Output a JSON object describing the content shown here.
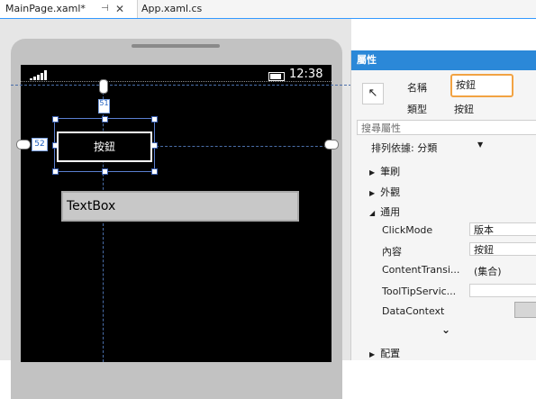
{
  "tabs": [
    {
      "label": "MainPage.xaml*",
      "active": true
    },
    {
      "label": "App.xaml.cs",
      "active": false
    }
  ],
  "designer": {
    "clock": "12:38",
    "button_text": "按鈕",
    "textbox_text": "TextBox",
    "margin_top": "51",
    "margin_left": "52"
  },
  "properties": {
    "title": "屬性",
    "name_label": "名稱",
    "name_value": "按鈕",
    "type_label": "類型",
    "type_value": "按鈕",
    "search_placeholder": "搜尋屬性",
    "arrange_by": "排列依據: 分類",
    "categories": {
      "brush": "筆刷",
      "appearance": "外觀",
      "common": "通用",
      "layout": "配置"
    },
    "common_props": [
      {
        "name": "ClickMode",
        "value": "版本"
      },
      {
        "name": "內容",
        "value": "按鈕"
      },
      {
        "name": "ContentTransi...",
        "value": "(集合)"
      },
      {
        "name": "ToolTipServic...",
        "value": ""
      },
      {
        "name": "DataContext",
        "value": ""
      }
    ]
  },
  "colors": {
    "accent": "#2b88d8",
    "highlight": "#f2a343"
  }
}
